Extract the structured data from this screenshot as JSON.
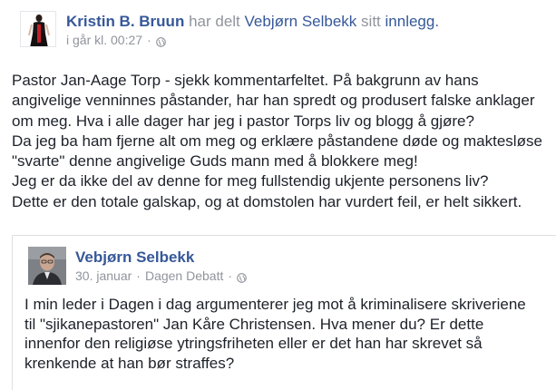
{
  "post": {
    "author": "Kristin B. Bruun",
    "action_text": "har delt",
    "shared_owner": "Vebjørn Selbekk",
    "suffix_text": "sitt",
    "shared_object": "innlegg.",
    "timestamp": "i går kl. 00:27",
    "separator": "·",
    "privacy_icon": "globe-icon",
    "body_lines": [
      "Pastor Jan-Aage Torp - sjekk kommentarfeltet. På bakgrunn av hans",
      "angivelige venninnes påstander, har han spredt og produsert falske anklager",
      "om meg. Hva i alle dager har jeg i pastor Torps liv og blogg å gjøre?",
      "Da jeg ba ham fjerne alt om meg og erklære påstandene døde og maktesløse",
      "\"svarte\" denne angivelige Guds mann med å blokkere meg!",
      "Jeg er da ikke del av denne for meg fullstendig ukjente personens liv?",
      "Dette er den totale galskap, og at domstolen har vurdert feil, er helt sikkert."
    ]
  },
  "shared_post": {
    "author": "Vebjørn Selbekk",
    "date": "30. januar",
    "separator": "·",
    "source": "Dagen Debatt",
    "privacy_icon": "globe-icon",
    "body_lines": [
      "I min leder i Dagen i dag argumenterer jeg mot å kriminalisere skriveriene",
      "til \"sjikanepastoren\" Jan Kåre Christensen. Hva mener du? Er dette",
      "innenfor den religiøse ytringsfriheten eller er det han har skrevet så",
      "krenkende at han bør straffes?"
    ]
  },
  "colors": {
    "link": "#365899",
    "text": "#1d2129",
    "muted": "#90949c",
    "border": "#dddfe2"
  }
}
